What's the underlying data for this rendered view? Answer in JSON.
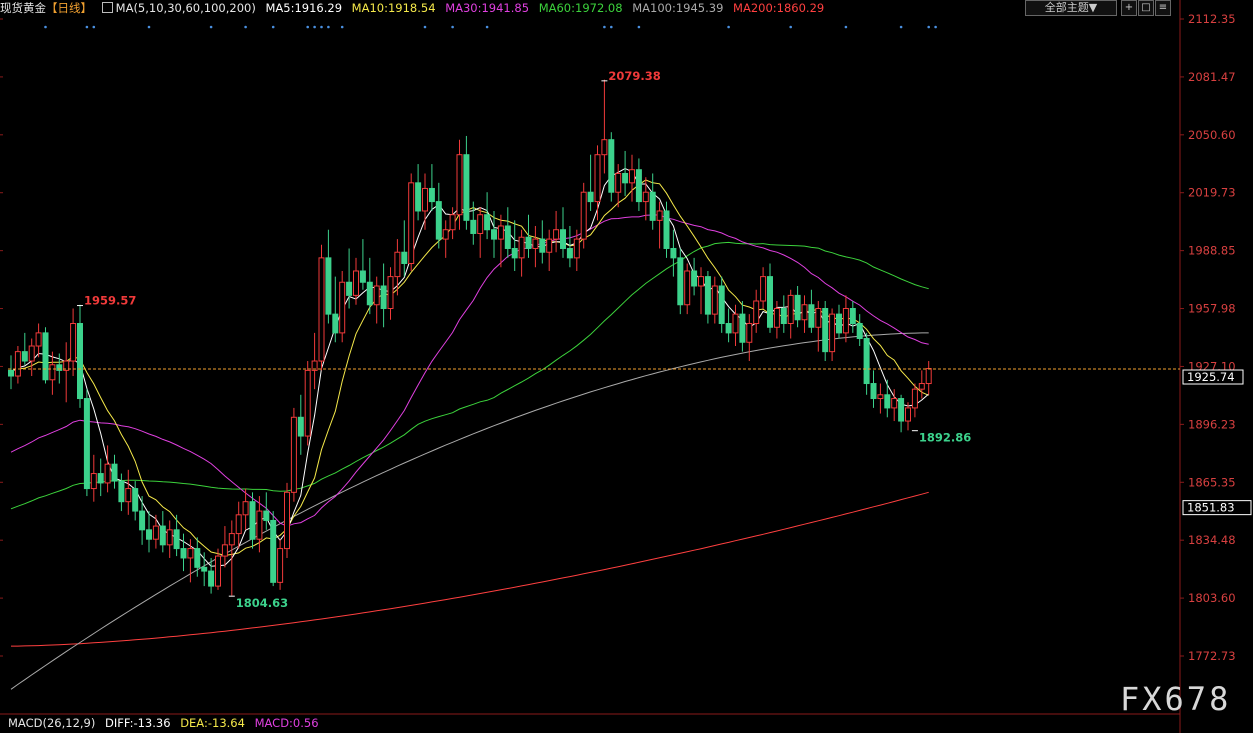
{
  "header": {
    "title": "现货黄金",
    "period": "【日线】",
    "ma_params": "MA(5,10,30,60,100,200)",
    "ma5": "MA5:1916.29",
    "ma10": "MA10:1918.54",
    "ma30": "MA30:1941.85",
    "ma60": "MA60:1972.08",
    "ma100": "MA100:1945.39",
    "ma200": "MA200:1860.29"
  },
  "toolbar": {
    "theme_select": "全部主题▼",
    "btn1": "+",
    "btn2": "□",
    "btn3": "≡"
  },
  "macd": {
    "label": "MACD(26,12,9)",
    "diff": "DIFF:-13.36",
    "dea": "DEA:-13.64",
    "macd": "MACD:0.56"
  },
  "watermark": "FX678",
  "colors": {
    "up": "#f03a3a",
    "down": "#3cd28c",
    "ma5": "#ffffff",
    "ma10": "#f5e94a",
    "ma30": "#e040e0",
    "ma60": "#3cd23c",
    "ma100": "#aaaaaa",
    "ma200": "#ff4040",
    "last_price_line": "#f0a030"
  },
  "chart_data": {
    "type": "candlestick",
    "y_ticks": [
      "2112.35",
      "2081.47",
      "2050.60",
      "2019.73",
      "1988.85",
      "1957.98",
      "1927.10",
      "1896.23",
      "1865.35",
      "1834.48",
      "1803.60",
      "1772.73"
    ],
    "ylim": [
      1760,
      2120
    ],
    "current_price": "1925.74",
    "current_price_value": 1925.74,
    "ma200_tag": "1851.83",
    "ma200_tag_value": 1851.83,
    "annotations": [
      {
        "text": "2079.38",
        "index": 86,
        "value": 2079.38,
        "kind": "high"
      },
      {
        "text": "1959.57",
        "index": 10,
        "value": 1959.57,
        "kind": "high"
      },
      {
        "text": "1804.63",
        "index": 32,
        "value": 1804.63,
        "kind": "low"
      },
      {
        "text": "1892.86",
        "index": 131,
        "value": 1892.86,
        "kind": "low"
      }
    ],
    "candles": [
      [
        1925,
        1933,
        1915,
        1922
      ],
      [
        1922,
        1938,
        1918,
        1935
      ],
      [
        1935,
        1945,
        1928,
        1930
      ],
      [
        1930,
        1942,
        1922,
        1938
      ],
      [
        1938,
        1950,
        1932,
        1945
      ],
      [
        1945,
        1948,
        1918,
        1920
      ],
      [
        1920,
        1935,
        1912,
        1928
      ],
      [
        1928,
        1934,
        1918,
        1925
      ],
      [
        1925,
        1940,
        1908,
        1930
      ],
      [
        1930,
        1958,
        1922,
        1950
      ],
      [
        1950,
        1960,
        1905,
        1910
      ],
      [
        1910,
        1915,
        1858,
        1862
      ],
      [
        1862,
        1880,
        1855,
        1870
      ],
      [
        1870,
        1878,
        1858,
        1865
      ],
      [
        1865,
        1885,
        1860,
        1875
      ],
      [
        1875,
        1880,
        1862,
        1866
      ],
      [
        1866,
        1870,
        1850,
        1855
      ],
      [
        1855,
        1872,
        1848,
        1862
      ],
      [
        1862,
        1866,
        1845,
        1850
      ],
      [
        1850,
        1858,
        1832,
        1840
      ],
      [
        1840,
        1850,
        1828,
        1835
      ],
      [
        1835,
        1848,
        1830,
        1842
      ],
      [
        1842,
        1850,
        1828,
        1832
      ],
      [
        1832,
        1845,
        1825,
        1840
      ],
      [
        1840,
        1848,
        1826,
        1830
      ],
      [
        1830,
        1838,
        1818,
        1825
      ],
      [
        1825,
        1835,
        1812,
        1830
      ],
      [
        1830,
        1836,
        1815,
        1820
      ],
      [
        1820,
        1828,
        1810,
        1818
      ],
      [
        1818,
        1825,
        1806,
        1810
      ],
      [
        1810,
        1830,
        1808,
        1826
      ],
      [
        1826,
        1842,
        1820,
        1832
      ],
      [
        1832,
        1845,
        1805,
        1838
      ],
      [
        1838,
        1855,
        1830,
        1848
      ],
      [
        1848,
        1862,
        1840,
        1855
      ],
      [
        1855,
        1860,
        1830,
        1835
      ],
      [
        1835,
        1858,
        1828,
        1850
      ],
      [
        1850,
        1860,
        1840,
        1845
      ],
      [
        1845,
        1850,
        1810,
        1812
      ],
      [
        1812,
        1835,
        1808,
        1830
      ],
      [
        1830,
        1865,
        1825,
        1860
      ],
      [
        1860,
        1905,
        1855,
        1900
      ],
      [
        1900,
        1912,
        1880,
        1890
      ],
      [
        1890,
        1930,
        1885,
        1925
      ],
      [
        1925,
        1945,
        1915,
        1930
      ],
      [
        1930,
        1992,
        1925,
        1985
      ],
      [
        1985,
        2000,
        1950,
        1955
      ],
      [
        1955,
        1975,
        1940,
        1945
      ],
      [
        1945,
        1978,
        1940,
        1972
      ],
      [
        1972,
        1990,
        1958,
        1965
      ],
      [
        1965,
        1985,
        1960,
        1978
      ],
      [
        1978,
        1995,
        1968,
        1972
      ],
      [
        1972,
        1985,
        1955,
        1960
      ],
      [
        1960,
        1975,
        1950,
        1970
      ],
      [
        1970,
        1982,
        1948,
        1958
      ],
      [
        1958,
        1980,
        1952,
        1975
      ],
      [
        1975,
        1995,
        1965,
        1988
      ],
      [
        1988,
        2005,
        1975,
        1982
      ],
      [
        1982,
        2030,
        1978,
        2025
      ],
      [
        2025,
        2035,
        2005,
        2010
      ],
      [
        2010,
        2030,
        2000,
        2022
      ],
      [
        2022,
        2035,
        2010,
        2015
      ],
      [
        2015,
        2025,
        1990,
        1995
      ],
      [
        1995,
        2005,
        1985,
        2000
      ],
      [
        2000,
        2012,
        1995,
        2008
      ],
      [
        2008,
        2048,
        2000,
        2040
      ],
      [
        2040,
        2050,
        2000,
        2005
      ],
      [
        2005,
        2015,
        1992,
        1998
      ],
      [
        1998,
        2012,
        1985,
        2008
      ],
      [
        2008,
        2020,
        1995,
        2000
      ],
      [
        2000,
        2010,
        1985,
        1995
      ],
      [
        1995,
        2008,
        1980,
        2002
      ],
      [
        2002,
        2012,
        1985,
        1990
      ],
      [
        1990,
        2005,
        1978,
        1985
      ],
      [
        1985,
        2000,
        1975,
        1996
      ],
      [
        1996,
        2008,
        1985,
        1990
      ],
      [
        1990,
        2002,
        1980,
        1995
      ],
      [
        1995,
        2005,
        1982,
        1988
      ],
      [
        1988,
        2000,
        1978,
        1995
      ],
      [
        1995,
        2010,
        1988,
        2000
      ],
      [
        2000,
        2012,
        1985,
        1990
      ],
      [
        1990,
        2002,
        1980,
        1985
      ],
      [
        1985,
        2000,
        1978,
        1995
      ],
      [
        1995,
        2025,
        1990,
        2020
      ],
      [
        2020,
        2040,
        2010,
        2015
      ],
      [
        2015,
        2045,
        2005,
        2040
      ],
      [
        2040,
        2080,
        2030,
        2048
      ],
      [
        2048,
        2052,
        2015,
        2020
      ],
      [
        2020,
        2035,
        2012,
        2030
      ],
      [
        2030,
        2042,
        2018,
        2025
      ],
      [
        2025,
        2040,
        2015,
        2032
      ],
      [
        2032,
        2038,
        2010,
        2015
      ],
      [
        2015,
        2028,
        2005,
        2020
      ],
      [
        2020,
        2030,
        2000,
        2005
      ],
      [
        2005,
        2015,
        1990,
        2010
      ],
      [
        2010,
        2015,
        1985,
        1990
      ],
      [
        1990,
        2000,
        1975,
        1985
      ],
      [
        1985,
        1990,
        1955,
        1960
      ],
      [
        1960,
        1982,
        1955,
        1978
      ],
      [
        1978,
        1985,
        1965,
        1970
      ],
      [
        1970,
        1980,
        1955,
        1975
      ],
      [
        1975,
        1978,
        1950,
        1955
      ],
      [
        1955,
        1975,
        1950,
        1970
      ],
      [
        1970,
        1975,
        1945,
        1950
      ],
      [
        1950,
        1958,
        1940,
        1945
      ],
      [
        1945,
        1960,
        1938,
        1955
      ],
      [
        1955,
        1962,
        1935,
        1940
      ],
      [
        1940,
        1955,
        1930,
        1950
      ],
      [
        1950,
        1968,
        1945,
        1962
      ],
      [
        1962,
        1980,
        1958,
        1975
      ],
      [
        1975,
        1982,
        1945,
        1948
      ],
      [
        1948,
        1962,
        1942,
        1958
      ],
      [
        1958,
        1965,
        1945,
        1950
      ],
      [
        1950,
        1968,
        1942,
        1965
      ],
      [
        1965,
        1970,
        1948,
        1952
      ],
      [
        1952,
        1965,
        1945,
        1960
      ],
      [
        1960,
        1968,
        1945,
        1948
      ],
      [
        1948,
        1962,
        1935,
        1958
      ],
      [
        1958,
        1962,
        1930,
        1935
      ],
      [
        1935,
        1958,
        1930,
        1955
      ],
      [
        1955,
        1960,
        1942,
        1945
      ],
      [
        1945,
        1965,
        1940,
        1958
      ],
      [
        1958,
        1962,
        1945,
        1950
      ],
      [
        1950,
        1955,
        1938,
        1942
      ],
      [
        1942,
        1945,
        1912,
        1918
      ],
      [
        1918,
        1925,
        1905,
        1910
      ],
      [
        1910,
        1918,
        1902,
        1912
      ],
      [
        1912,
        1920,
        1900,
        1905
      ],
      [
        1905,
        1915,
        1898,
        1910
      ],
      [
        1910,
        1912,
        1892,
        1898
      ],
      [
        1898,
        1908,
        1893,
        1905
      ],
      [
        1905,
        1918,
        1900,
        1915
      ],
      [
        1915,
        1925,
        1910,
        1918
      ],
      [
        1918,
        1930,
        1912,
        1926
      ]
    ]
  }
}
